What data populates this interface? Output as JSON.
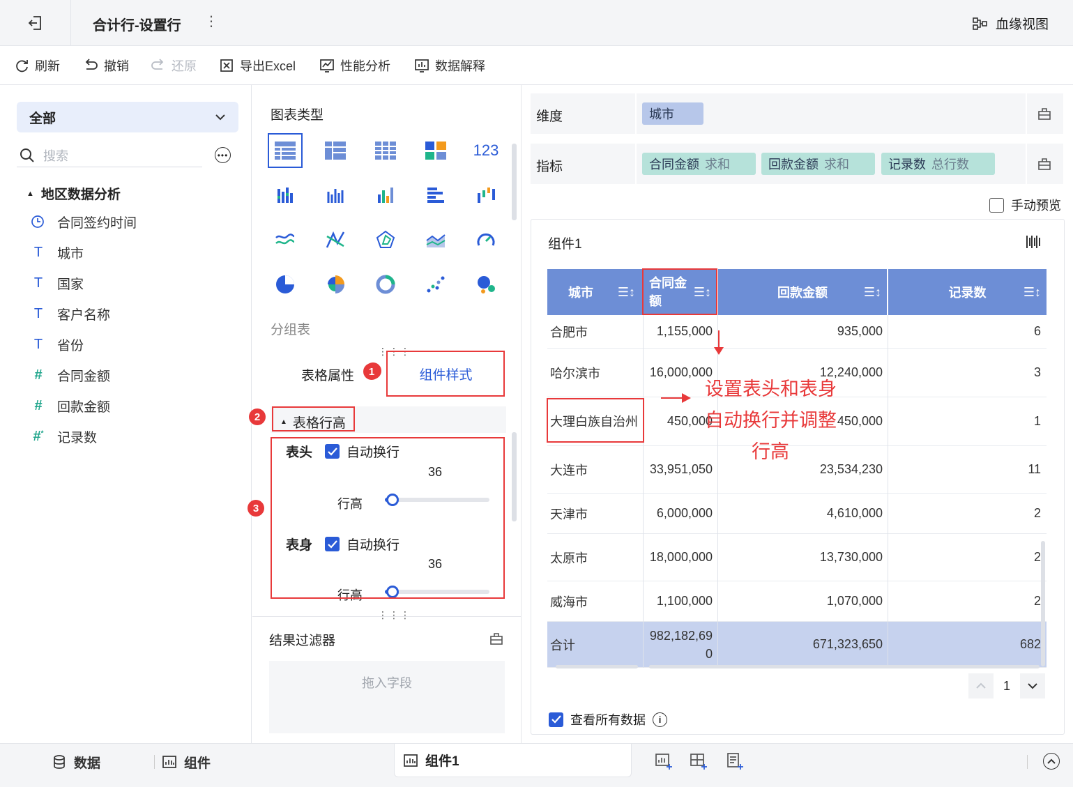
{
  "header": {
    "title": "合计行-设置行",
    "lineage_label": "血缘视图"
  },
  "toolbar": {
    "refresh": "刷新",
    "undo": "撤销",
    "redo": "还原",
    "export": "导出Excel",
    "perf": "性能分析",
    "explain": "数据解释"
  },
  "left": {
    "dropdown": "全部",
    "search_placeholder": "搜索",
    "folder": "地区数据分析",
    "fields": [
      {
        "label": "合同签约时间",
        "type": "date"
      },
      {
        "label": "城市",
        "type": "text"
      },
      {
        "label": "国家",
        "type": "text"
      },
      {
        "label": "客户名称",
        "type": "text"
      },
      {
        "label": "省份",
        "type": "text"
      },
      {
        "label": "合同金额",
        "type": "number"
      },
      {
        "label": "回款金额",
        "type": "number"
      },
      {
        "label": "记录数",
        "type": "calc-number"
      }
    ]
  },
  "middle": {
    "chart_type_label": "图表类型",
    "chart_name": "分组表",
    "tab_props": "表格属性",
    "tab_style": "组件样式",
    "section": "表格行高",
    "header_label": "表头",
    "body_label": "表身",
    "auto_wrap": "自动换行",
    "row_height": "行高",
    "header_height": "36",
    "body_height": "36",
    "filter_label": "结果过滤器",
    "drop_hint": "拖入字段",
    "badges": [
      "1",
      "2",
      "3"
    ]
  },
  "right": {
    "dimension_label": "维度",
    "dimension_field": "城市",
    "measure_label": "指标",
    "measures": [
      {
        "name": "合同金额",
        "agg": "求和"
      },
      {
        "name": "回款金额",
        "agg": "求和"
      },
      {
        "name": "记录数",
        "agg": "总行数"
      }
    ],
    "manual_preview": "手动预览",
    "component_title": "组件1",
    "view_all": "查看所有数据",
    "page": "1"
  },
  "table": {
    "columns": [
      "城市",
      "合同金额",
      "回款金额",
      "记录数"
    ],
    "rows": [
      [
        "合肥市",
        "1,155,000",
        "935,000",
        "6"
      ],
      [
        "哈尔滨市",
        "16,000,000",
        "12,240,000",
        "3"
      ],
      [
        "大理白族自治州",
        "450,000",
        "450,000",
        "1"
      ],
      [
        "大连市",
        "33,951,050",
        "23,534,230",
        "11"
      ],
      [
        "天津市",
        "6,000,000",
        "4,610,000",
        "2"
      ],
      [
        "太原市",
        "18,000,000",
        "13,730,000",
        "2"
      ],
      [
        "威海市",
        "1,100,000",
        "1,070,000",
        "2"
      ]
    ],
    "total": [
      "合计",
      "982,182,690",
      "671,323,650",
      "682"
    ]
  },
  "annotation": {
    "line1": "设置表头和表身",
    "line2": "自动换行并调整",
    "line3": "行高"
  },
  "bottom": {
    "data_tab": "数据",
    "component_tab": "组件",
    "active_tab": "组件1"
  },
  "colors": {
    "accent": "#2a5bd7",
    "table_header": "#6d8ed6",
    "highlight": "#e8393a",
    "total_row": "#c6d2ee",
    "dim_pill": "#b7c7ea",
    "measure_pill": "#b6e2da"
  }
}
